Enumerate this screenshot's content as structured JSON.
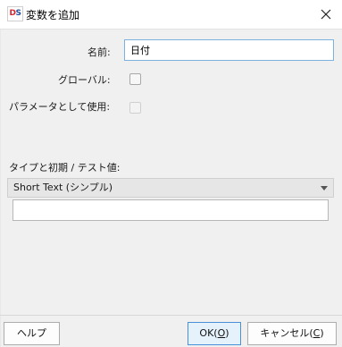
{
  "window": {
    "logo_text_d": "D",
    "logo_text_s": "S",
    "title": "変数を追加"
  },
  "form": {
    "name_label": "名前:",
    "name_value": "日付",
    "global_label": "グローバル:",
    "global_checked": false,
    "param_label": "パラメータとして使用:",
    "param_checked": false,
    "type_label": "タイプと初期 / テスト値:",
    "type_selected": "Short Text (シンプル)",
    "initial_value": ""
  },
  "buttons": {
    "help": "ヘルプ",
    "ok_prefix": "OK(",
    "ok_mnemonic": "O",
    "ok_suffix": ")",
    "cancel_prefix": "キャンセル(",
    "cancel_mnemonic": "C",
    "cancel_suffix": ")"
  },
  "colors": {
    "logo_d": "#d9232d",
    "logo_s": "#1f4e9a",
    "focus_border": "#7bb2e0",
    "default_button_border": "#4a90d9"
  },
  "icons": {
    "close": "close-icon",
    "dropdown": "chevron-down-icon"
  }
}
